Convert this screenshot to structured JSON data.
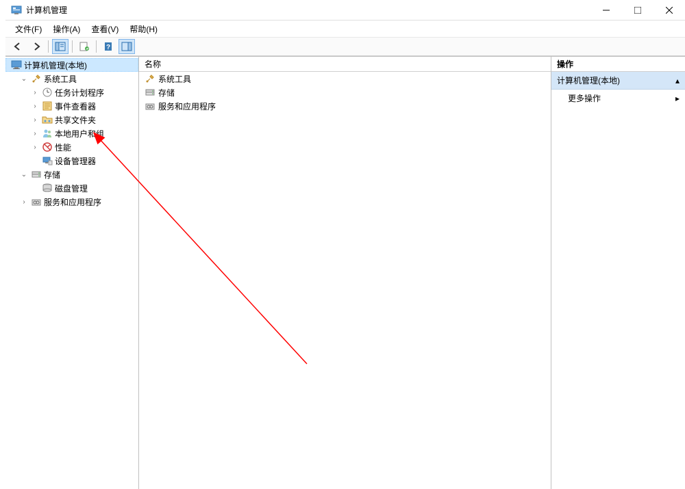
{
  "window": {
    "title": "计算机管理"
  },
  "menu": {
    "file": "文件(F)",
    "action": "操作(A)",
    "view": "查看(V)",
    "help": "帮助(H)"
  },
  "tree": {
    "root": "计算机管理(本地)",
    "systemTools": "系统工具",
    "taskScheduler": "任务计划程序",
    "eventViewer": "事件查看器",
    "sharedFolders": "共享文件夹",
    "localUsersGroups": "本地用户和组",
    "performance": "性能",
    "deviceManager": "设备管理器",
    "storage": "存储",
    "diskManagement": "磁盘管理",
    "servicesApps": "服务和应用程序"
  },
  "list": {
    "header": "名称",
    "items": {
      "systemTools": "系统工具",
      "storage": "存储",
      "servicesApps": "服务和应用程序"
    }
  },
  "actions": {
    "header": "操作",
    "group": "计算机管理(本地)",
    "moreActions": "更多操作"
  }
}
